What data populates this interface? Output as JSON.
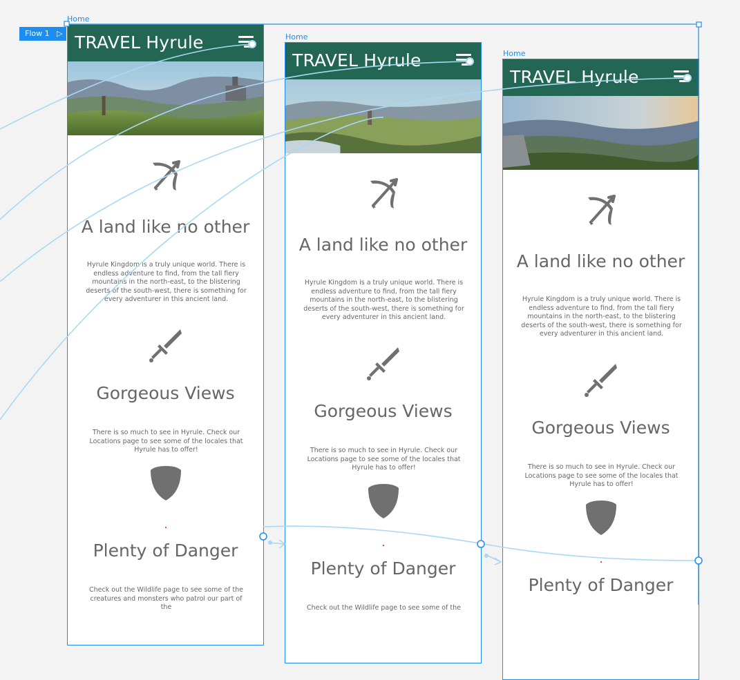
{
  "flow": {
    "label": "Flow 1",
    "play_icon": "play-icon"
  },
  "frames": [
    {
      "label": "Home",
      "brand": "TRAVEL Hyrule",
      "menu_icon": "hamburger-menu-icon",
      "sections": [
        {
          "icon": "bow-and-arrow-icon",
          "heading": "A land like no other",
          "text": "Hyrule Kingdom is a truly unique world. There is endless adventure to find, from the tall fiery mountains in the north-east, to the blistering deserts of the south-west, there is something for every adventurer in this ancient land."
        },
        {
          "icon": "sword-icon",
          "heading": "Gorgeous Views",
          "text": "There is so much to see in Hyrule. Check our Locations page to see some of the locales that Hyrule has to offer!"
        },
        {
          "icon": "shield-icon",
          "heading": "Plenty of Danger",
          "text": "Check out the Wildlife page to see some of the creatures and monsters who patrol our part of the"
        }
      ]
    },
    {
      "label": "Home",
      "brand": "TRAVEL Hyrule",
      "menu_icon": "hamburger-menu-icon",
      "sections": [
        {
          "icon": "bow-and-arrow-icon",
          "heading": "A land like no other",
          "text": "Hyrule Kingdom is a truly unique world. There is endless adventure to find, from the tall fiery mountains in the north-east, to the blistering deserts of the south-west, there is something for every adventurer in this ancient land."
        },
        {
          "icon": "sword-icon",
          "heading": "Gorgeous Views",
          "text": "There is so much to see in Hyrule. Check our Locations page to see some of the locales that Hyrule has to offer!"
        },
        {
          "icon": "shield-icon",
          "heading": "Plenty of Danger",
          "text": "Check out the Wildlife page to see some of the"
        }
      ]
    },
    {
      "label": "Home",
      "brand": "TRAVEL Hyrule",
      "menu_icon": "hamburger-menu-icon",
      "sections": [
        {
          "icon": "bow-and-arrow-icon",
          "heading": "A land like no other",
          "text": "Hyrule Kingdom is a truly unique world. There is endless adventure to find, from the tall fiery mountains in the north-east, to the blistering deserts of the south-west, there is something for every adventurer in this ancient land."
        },
        {
          "icon": "sword-icon",
          "heading": "Gorgeous Views",
          "text": "There is so much to see in Hyrule. Check our Locations page to see some of the locales that Hyrule has to offer!"
        },
        {
          "icon": "shield-icon",
          "heading": "Plenty of Danger",
          "text": ""
        }
      ]
    }
  ],
  "colors": {
    "header_green": "#236654",
    "selection_blue": "#1d8ef0",
    "wire_blue": "#a9d8f5",
    "icon_gray": "#707070",
    "text_gray": "#666666",
    "canvas": "#f3f3f3"
  }
}
